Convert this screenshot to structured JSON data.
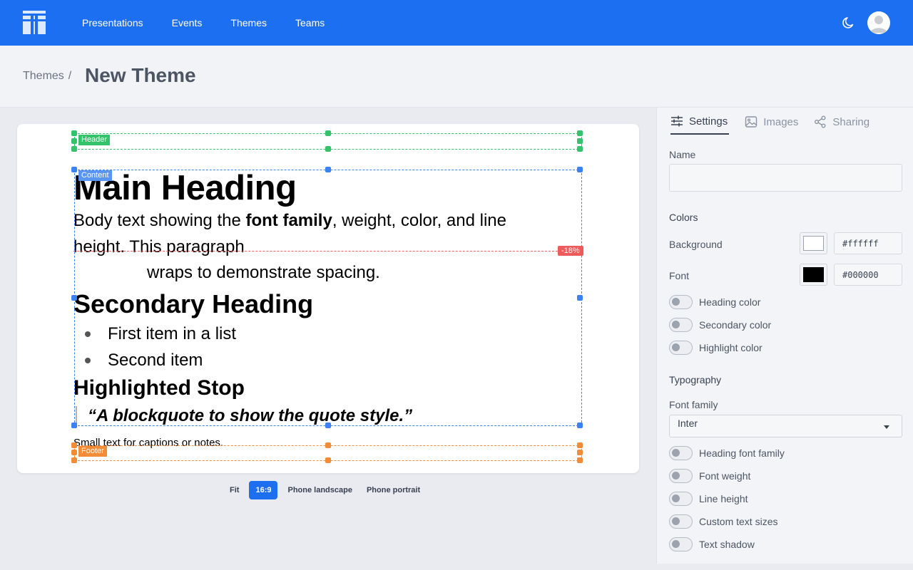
{
  "nav": {
    "links": [
      "Presentations",
      "Events",
      "Themes",
      "Teams"
    ]
  },
  "page": {
    "breadcrumb": "Themes",
    "breadcrumb_sep": "/",
    "title": "New Theme"
  },
  "slide": {
    "regions": {
      "header": "Header",
      "content": "Content",
      "footer": "Footer"
    },
    "guide_label": "-18%",
    "main_heading": "Main Heading",
    "body_pre": "Body text showing the ",
    "body_bold": "font family",
    "body_post": ", weight, color, and line",
    "body_line2": "height. This paragraph",
    "body_line3": "wraps to demonstrate spacing.",
    "secondary_heading": "Secondary Heading",
    "list": [
      "First item in a list",
      "Second item"
    ],
    "highlight": "Highlighted Stop",
    "quote": "“A blockquote to show the quote style.”",
    "small": "Small text for captions or notes."
  },
  "ratios": [
    "Fit",
    "16:9",
    "Phone landscape",
    "Phone portrait"
  ],
  "ratio_selected": "16:9",
  "panel": {
    "tabs": [
      "Settings",
      "Images",
      "Sharing"
    ],
    "active_tab": "Settings",
    "name_label": "Name",
    "name_value": "",
    "colors_title": "Colors",
    "background_label": "Background",
    "background_hex": "#ffffff",
    "font_label": "Font",
    "font_hex": "#000000",
    "color_toggles": [
      "Heading color",
      "Secondary color",
      "Highlight color"
    ],
    "typography_title": "Typography",
    "font_family_label": "Font family",
    "font_family_value": "Inter",
    "typography_toggles": [
      "Heading font family",
      "Font weight",
      "Line height",
      "Custom text sizes",
      "Text shadow"
    ]
  },
  "colors": {
    "nav": "#1d6ff2",
    "header_region": "#34c36b",
    "content_region": "#3b82f6",
    "footer_region": "#f28c36",
    "guide": "#ef5a5a"
  }
}
